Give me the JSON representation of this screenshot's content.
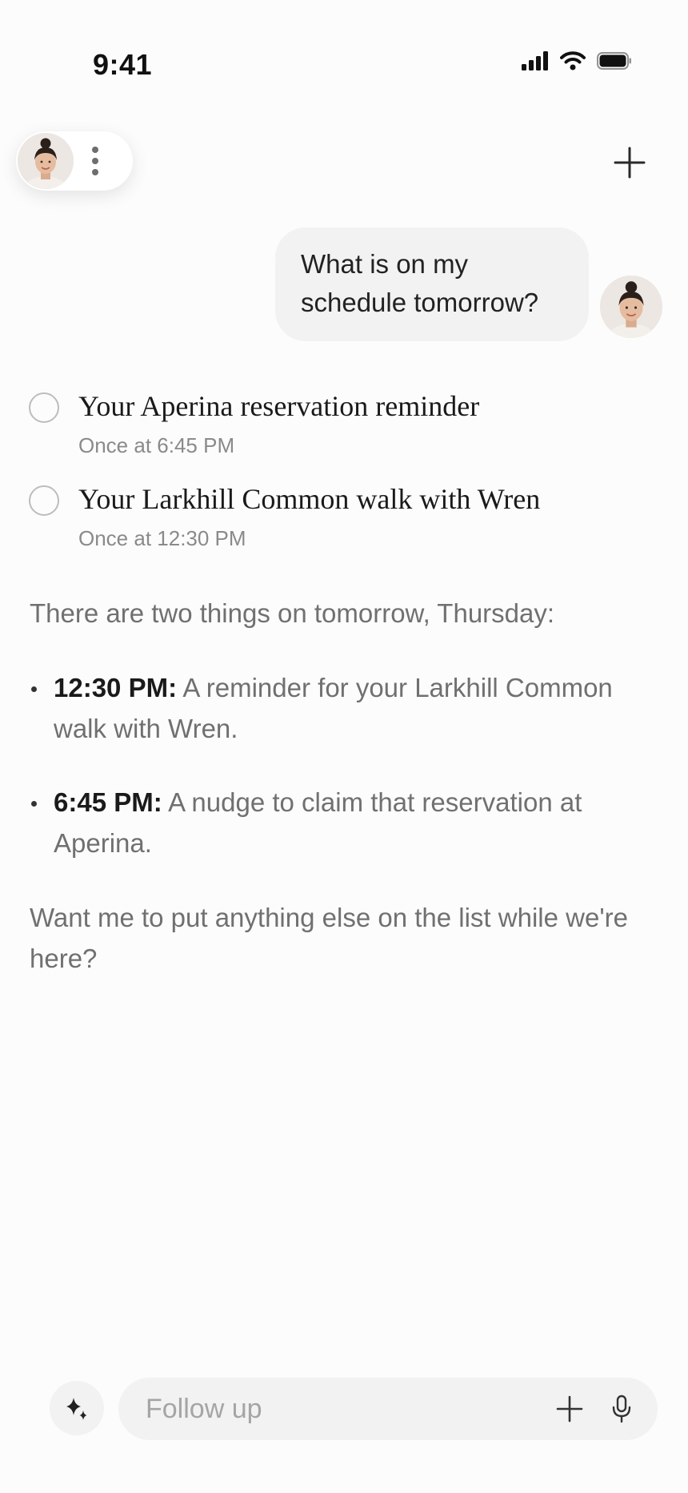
{
  "status_bar": {
    "time": "9:41"
  },
  "header": {
    "profile_icon": "avatar",
    "menu_icon": "more-vertical-icon",
    "new_chat_icon": "plus-icon"
  },
  "conversation": {
    "user_message": "What is on my schedule tomorrow?",
    "reminders": [
      {
        "title": "Your Aperina reservation reminder",
        "schedule": "Once at 6:45 PM"
      },
      {
        "title": "Your Larkhill Common walk with Wren",
        "schedule": "Once at 12:30 PM"
      }
    ],
    "response": {
      "intro": "There are two things on tomorrow, Thursday:",
      "items": [
        {
          "time": "12:30 PM:",
          "text": " A reminder for your Larkhill Common walk with Wren."
        },
        {
          "time": "6:45 PM:",
          "text": " A nudge to claim that reservation at Aperina."
        }
      ],
      "outro": "Want me to put anything else on the list while we're here?"
    }
  },
  "composer": {
    "placeholder": "Follow up",
    "value": "",
    "sparkle_icon": "sparkle-icon",
    "add_icon": "plus-icon",
    "mic_icon": "microphone-icon"
  },
  "colors": {
    "background": "#fcfcfc",
    "bubble": "#f1f2f1",
    "text_primary": "#1a1a1a",
    "text_secondary": "#707070",
    "text_muted": "#8a8a8a"
  }
}
